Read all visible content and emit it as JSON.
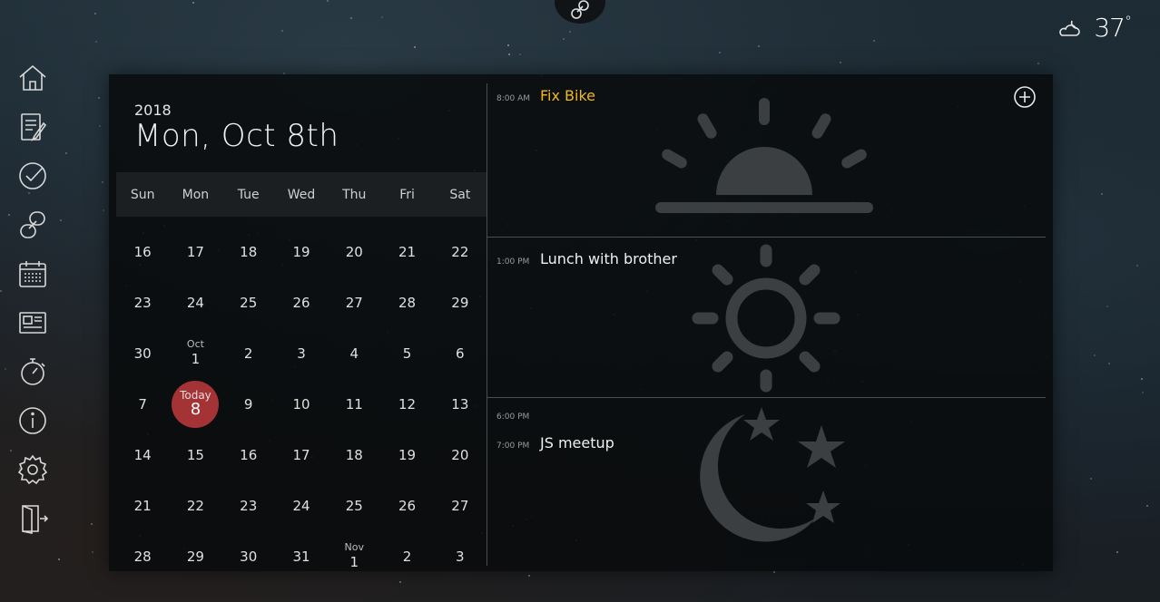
{
  "weather": {
    "icon": "cloudy-night-icon",
    "temp": "37",
    "degree": "°"
  },
  "sidebar": {
    "items": [
      {
        "icon": "home-icon"
      },
      {
        "icon": "notes-icon"
      },
      {
        "icon": "tasks-icon"
      },
      {
        "icon": "link-icon"
      },
      {
        "icon": "calendar-icon"
      },
      {
        "icon": "news-icon"
      },
      {
        "icon": "timer-icon"
      },
      {
        "icon": "info-icon"
      },
      {
        "icon": "settings-icon"
      },
      {
        "icon": "logout-icon"
      }
    ]
  },
  "calendar": {
    "year": "2018",
    "title": "Mon, Oct 8th",
    "weekdays": [
      "Sun",
      "Mon",
      "Tue",
      "Wed",
      "Thu",
      "Fri",
      "Sat"
    ],
    "weeks": [
      [
        {
          "n": "16"
        },
        {
          "n": "17"
        },
        {
          "n": "18"
        },
        {
          "n": "19"
        },
        {
          "n": "20"
        },
        {
          "n": "21"
        },
        {
          "n": "22"
        }
      ],
      [
        {
          "n": "23"
        },
        {
          "n": "24"
        },
        {
          "n": "25"
        },
        {
          "n": "26"
        },
        {
          "n": "27"
        },
        {
          "n": "28"
        },
        {
          "n": "29"
        }
      ],
      [
        {
          "n": "30"
        },
        {
          "m": "Oct",
          "n": "1"
        },
        {
          "n": "2"
        },
        {
          "n": "3"
        },
        {
          "n": "4"
        },
        {
          "n": "5"
        },
        {
          "n": "6"
        }
      ],
      [
        {
          "n": "7"
        },
        {
          "m": "Today",
          "n": "8",
          "today": true
        },
        {
          "n": "9"
        },
        {
          "n": "10"
        },
        {
          "n": "11"
        },
        {
          "n": "12"
        },
        {
          "n": "13"
        }
      ],
      [
        {
          "n": "14"
        },
        {
          "n": "15"
        },
        {
          "n": "16"
        },
        {
          "n": "17"
        },
        {
          "n": "18"
        },
        {
          "n": "19"
        },
        {
          "n": "20"
        }
      ],
      [
        {
          "n": "21"
        },
        {
          "n": "22"
        },
        {
          "n": "23"
        },
        {
          "n": "24"
        },
        {
          "n": "25"
        },
        {
          "n": "26"
        },
        {
          "n": "27"
        }
      ],
      [
        {
          "n": "28"
        },
        {
          "n": "29"
        },
        {
          "n": "30"
        },
        {
          "n": "31"
        },
        {
          "m": "Nov",
          "n": "1"
        },
        {
          "n": "2"
        },
        {
          "n": "3"
        }
      ]
    ],
    "today_color": "#a33335"
  },
  "agenda": {
    "add_icon": "add-circle-icon",
    "slots": [
      {
        "icon": "sunrise-icon",
        "events": [
          {
            "time": "8:00 AM",
            "title": "Fix Bike",
            "highlight": true
          }
        ]
      },
      {
        "icon": "sun-icon",
        "events": [
          {
            "time": "1:00 PM",
            "title": "Lunch with brother"
          }
        ]
      },
      {
        "icon": "moon-stars-icon",
        "events": [
          {
            "time": "6:00 PM",
            "title": ""
          },
          {
            "time": "7:00 PM",
            "title": "JS meetup"
          }
        ]
      }
    ],
    "highlight_color": "#f0b81f"
  }
}
